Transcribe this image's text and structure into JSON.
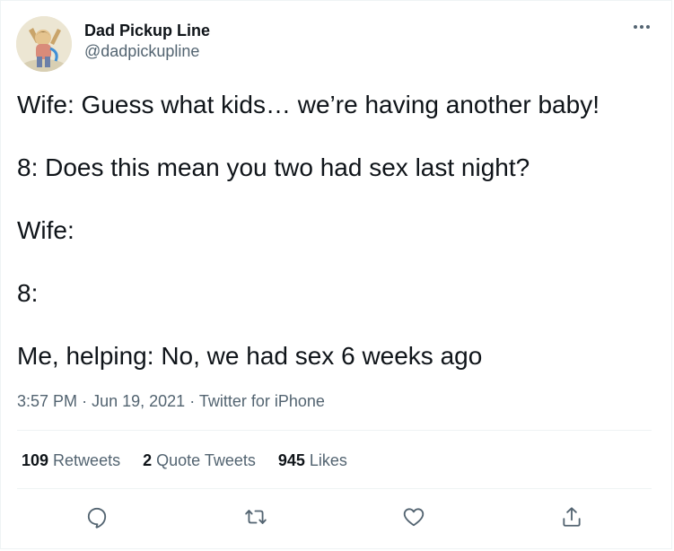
{
  "author": {
    "display_name": "Dad Pickup Line",
    "handle": "@dadpickupline",
    "avatar_icon": "cartoon-avatar"
  },
  "tweet": {
    "lines": [
      "Wife: Guess what kids… we’re having another baby!",
      "8: Does this mean you two had sex last night?",
      "Wife:",
      "8:",
      "Me, helping: No, we had sex 6 weeks ago"
    ],
    "time": "3:57 PM",
    "separator": "·",
    "date": "Jun 19, 2021",
    "source": "Twitter for iPhone"
  },
  "stats": {
    "retweets_count": "109",
    "retweets_label": "Retweets",
    "quotes_count": "2",
    "quotes_label": "Quote Tweets",
    "likes_count": "945",
    "likes_label": "Likes"
  },
  "actions": {
    "reply_icon": "reply-icon",
    "retweet_icon": "retweet-icon",
    "like_icon": "like-icon",
    "share_icon": "share-icon"
  },
  "colors": {
    "text_primary": "#0f1419",
    "text_secondary": "#536471",
    "divider": "#eff3f4"
  }
}
